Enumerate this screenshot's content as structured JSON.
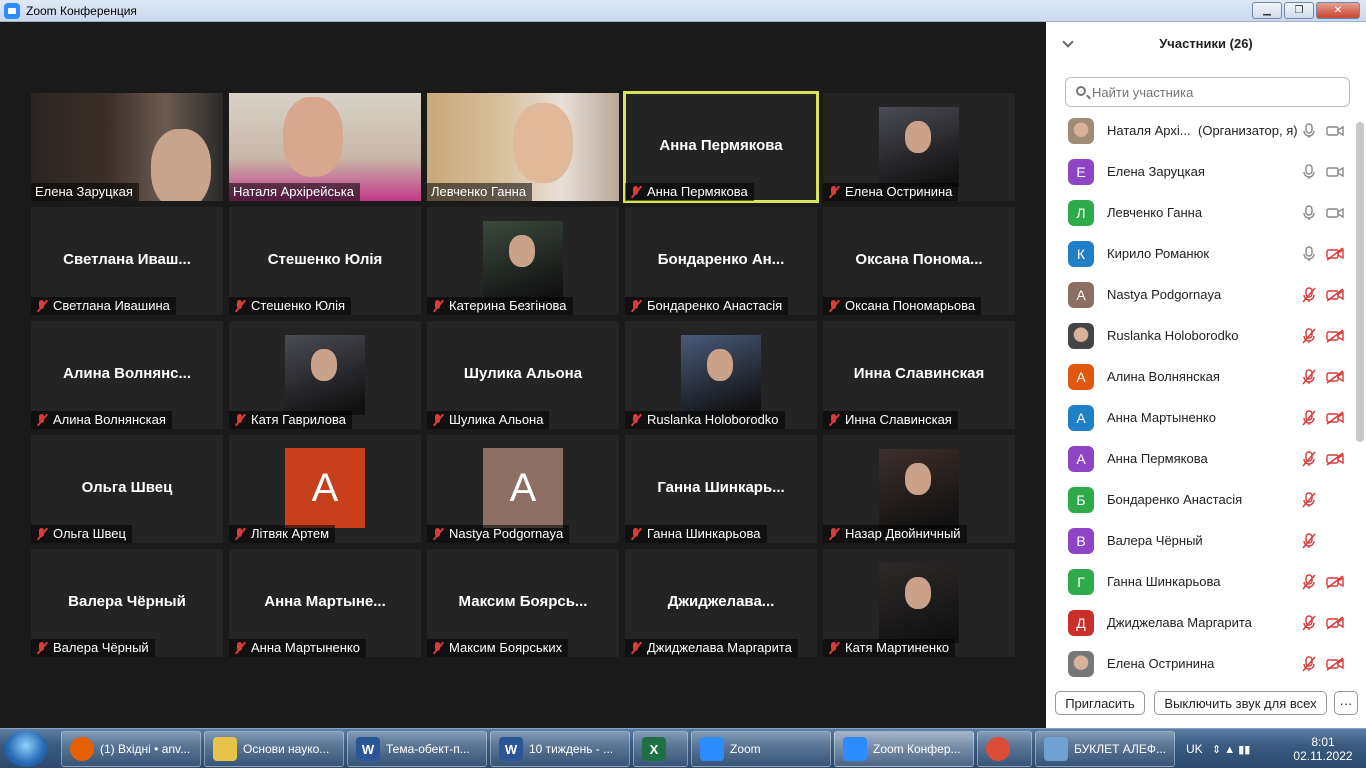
{
  "window": {
    "title": "Zoom Конференция"
  },
  "tiles": [
    {
      "label": "Елена Заруцкая",
      "muted": false,
      "kind": "video"
    },
    {
      "label": "Наталя Архірейська",
      "muted": false,
      "kind": "video"
    },
    {
      "label": "Левченко Ганна",
      "muted": false,
      "kind": "video"
    },
    {
      "label": "Анна Пермякова",
      "big": "Анна Пермякова",
      "muted": true,
      "kind": "name",
      "active": true
    },
    {
      "label": "Елена Остринина",
      "muted": true,
      "kind": "photo"
    },
    {
      "label": "Светлана Ивашина",
      "big": "Светлана Иваш...",
      "muted": true,
      "kind": "name"
    },
    {
      "label": "Стешенко Юлія",
      "big": "Стешенко Юлія",
      "muted": true,
      "kind": "name"
    },
    {
      "label": "Катерина Безгінова",
      "muted": true,
      "kind": "photo"
    },
    {
      "label": "Бондаренко Анастасія",
      "big": "Бондаренко  Ан...",
      "muted": true,
      "kind": "name"
    },
    {
      "label": "Оксана Пономарьова",
      "big": "Оксана  Понома...",
      "muted": true,
      "kind": "name"
    },
    {
      "label": "Алина Волнянская",
      "big": "Алина  Волнянс...",
      "muted": true,
      "kind": "name"
    },
    {
      "label": "Катя Гаврилова",
      "muted": true,
      "kind": "photo"
    },
    {
      "label": "Шулика Альона",
      "big": "Шулика Альона",
      "muted": true,
      "kind": "name"
    },
    {
      "label": "Ruslanka Holoborodko",
      "muted": true,
      "kind": "photo"
    },
    {
      "label": "Инна Славинская",
      "big": "Инна Славинская",
      "muted": true,
      "kind": "name"
    },
    {
      "label": "Ольга Швец",
      "big": "Ольга Швец",
      "muted": true,
      "kind": "name"
    },
    {
      "label": "Літвяк Артем",
      "muted": true,
      "kind": "avatar",
      "letter": "A",
      "color": "#c7401b"
    },
    {
      "label": "Nastya Podgornaya",
      "muted": true,
      "kind": "avatar",
      "letter": "A",
      "color": "#8d6e63"
    },
    {
      "label": "Ганна Шинкарьова",
      "big": "Ганна  Шинкарь...",
      "muted": true,
      "kind": "name"
    },
    {
      "label": "Назар Двойничный",
      "muted": true,
      "kind": "photo"
    },
    {
      "label": "Валера Чёрный",
      "big": "Валера Чёрный",
      "muted": true,
      "kind": "name"
    },
    {
      "label": "Анна Мартыненко",
      "big": "Анна  Мартыне...",
      "muted": true,
      "kind": "name"
    },
    {
      "label": "Максим Боярських",
      "big": "Максим  Боярсь...",
      "muted": true,
      "kind": "name"
    },
    {
      "label": "Джиджелава Маргарита",
      "big": "Джиджелава...",
      "muted": true,
      "kind": "name"
    },
    {
      "label": "Катя Мартиненко",
      "muted": true,
      "kind": "photo"
    }
  ],
  "panel": {
    "title": "Участники (26)",
    "search_placeholder": "Найти участника",
    "participants": [
      {
        "name": "Наталя Архі...",
        "role": "(Организатор, я)",
        "avatar": "photo",
        "color": "#a08a78",
        "mic": "on",
        "cam": "on"
      },
      {
        "name": "Елена Заруцкая",
        "avatar": "Е",
        "color": "#8e44c4",
        "mic": "on",
        "cam": "on"
      },
      {
        "name": "Левченко Ганна",
        "avatar": "Л",
        "color": "#2eaa4a",
        "mic": "on",
        "cam": "on"
      },
      {
        "name": "Кирило Романюк",
        "avatar": "К",
        "color": "#1f7fc7",
        "mic": "on",
        "cam": "off"
      },
      {
        "name": "Nastya Podgornaya",
        "avatar": "A",
        "color": "#8d6e63",
        "mic": "off",
        "cam": "off"
      },
      {
        "name": "Ruslanka Holoborodko",
        "avatar": "photo",
        "color": "#444",
        "mic": "off",
        "cam": "off"
      },
      {
        "name": "Алина Волнянская",
        "avatar": "А",
        "color": "#e0580e",
        "mic": "off",
        "cam": "off"
      },
      {
        "name": "Анна Мартыненко",
        "avatar": "А",
        "color": "#1f7fc7",
        "mic": "off",
        "cam": "off"
      },
      {
        "name": "Анна Пермякова",
        "avatar": "А",
        "color": "#8e44c4",
        "mic": "off",
        "cam": "off"
      },
      {
        "name": "Бондаренко Анастасія",
        "avatar": "Б",
        "color": "#2eaa4a",
        "mic": "off",
        "cam": "none"
      },
      {
        "name": "Валера Чёрный",
        "avatar": "В",
        "color": "#8e44c4",
        "mic": "off",
        "cam": "none"
      },
      {
        "name": "Ганна Шинкарьова",
        "avatar": "Г",
        "color": "#2eaa4a",
        "mic": "off",
        "cam": "off"
      },
      {
        "name": "Джиджелава Маргарита",
        "avatar": "Д",
        "color": "#c9302c",
        "mic": "off",
        "cam": "off"
      },
      {
        "name": "Елена Остринина",
        "avatar": "photo",
        "color": "#777",
        "mic": "off",
        "cam": "off"
      }
    ],
    "invite_label": "Пригласить",
    "mute_all_label": "Выключить звук для всех",
    "more_label": "···"
  },
  "taskbar": {
    "items": [
      {
        "label": "(1) Вхідні • anv...",
        "icon": "firefox-icon",
        "color": "#e66000"
      },
      {
        "label": "Основи науко...",
        "icon": "folder-icon",
        "color": "#e8c34a"
      },
      {
        "label": "Тема-обект-п...",
        "icon": "word-icon",
        "color": "#2b5797",
        "letter": "W"
      },
      {
        "label": "10 тиждень - ...",
        "icon": "word-icon",
        "color": "#2b5797",
        "letter": "W"
      },
      {
        "label": "",
        "icon": "excel-icon",
        "color": "#1e7145",
        "letter": "X"
      },
      {
        "label": "Zoom",
        "icon": "zoom-icon",
        "color": "#2d8cff"
      },
      {
        "label": "Zoom Конфер...",
        "icon": "zoom-icon",
        "color": "#2d8cff"
      },
      {
        "label": "",
        "icon": "chrome-icon",
        "color": "#dd4b39"
      },
      {
        "label": "БУКЛЕТ АЛЕФ...",
        "icon": "image-icon",
        "color": "#6fa3d4"
      }
    ],
    "lang": "UK",
    "time": "8:01",
    "date": "02.11.2022"
  }
}
